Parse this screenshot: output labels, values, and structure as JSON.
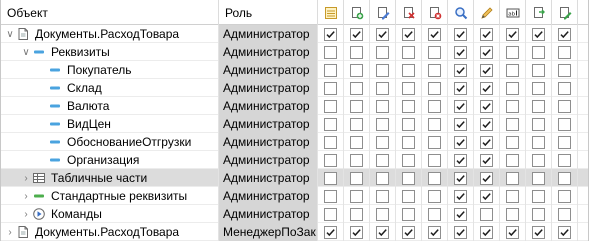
{
  "header": {
    "object_label": "Объект",
    "role_label": "Роль",
    "permission_icons": [
      "rights-table-icon",
      "add-icon",
      "edit-icon",
      "mark-delete-icon",
      "delete-icon",
      "view-icon",
      "interactive-edit-icon",
      "text-input-icon",
      "export-icon",
      "edit-green-icon"
    ]
  },
  "rows": [
    {
      "level": 0,
      "expander": "open",
      "icon": "document-icon",
      "object": "Документы.РасходТовара",
      "role": "Администратор",
      "checks": [
        true,
        true,
        true,
        true,
        true,
        true,
        true,
        true,
        true,
        true
      ],
      "selected": false
    },
    {
      "level": 1,
      "expander": "open",
      "icon": "attribute-group-icon",
      "object": "Реквизиты",
      "role": "Администратор",
      "checks": [
        false,
        false,
        false,
        false,
        false,
        true,
        true,
        false,
        false,
        false
      ],
      "selected": false
    },
    {
      "level": 2,
      "expander": "none",
      "icon": "attribute-icon",
      "object": "Покупатель",
      "role": "Администратор",
      "checks": [
        false,
        false,
        false,
        false,
        false,
        true,
        true,
        false,
        false,
        false
      ],
      "selected": false
    },
    {
      "level": 2,
      "expander": "none",
      "icon": "attribute-icon",
      "object": "Склад",
      "role": "Администратор",
      "checks": [
        false,
        false,
        false,
        false,
        false,
        true,
        true,
        false,
        false,
        false
      ],
      "selected": false
    },
    {
      "level": 2,
      "expander": "none",
      "icon": "attribute-icon",
      "object": "Валюта",
      "role": "Администратор",
      "checks": [
        false,
        false,
        false,
        false,
        false,
        true,
        true,
        false,
        false,
        false
      ],
      "selected": false
    },
    {
      "level": 2,
      "expander": "none",
      "icon": "attribute-icon",
      "object": "ВидЦен",
      "role": "Администратор",
      "checks": [
        false,
        false,
        false,
        false,
        false,
        true,
        true,
        false,
        false,
        false
      ],
      "selected": false
    },
    {
      "level": 2,
      "expander": "none",
      "icon": "attribute-icon",
      "object": "ОбоснованиеОтгрузки",
      "role": "Администратор",
      "checks": [
        false,
        false,
        false,
        false,
        false,
        true,
        true,
        false,
        false,
        false
      ],
      "selected": false
    },
    {
      "level": 2,
      "expander": "none",
      "icon": "attribute-icon",
      "object": "Организация",
      "role": "Администратор",
      "checks": [
        false,
        false,
        false,
        false,
        false,
        true,
        true,
        false,
        false,
        false
      ],
      "selected": false
    },
    {
      "level": 1,
      "expander": "closed",
      "icon": "table-icon",
      "object": "Табличные части",
      "role": "Администратор",
      "checks": [
        false,
        false,
        false,
        false,
        false,
        true,
        true,
        false,
        false,
        false
      ],
      "selected": true
    },
    {
      "level": 1,
      "expander": "closed",
      "icon": "standard-attribute-icon",
      "object": "Стандартные реквизиты",
      "role": "Администратор",
      "checks": [
        false,
        false,
        false,
        false,
        false,
        true,
        true,
        false,
        false,
        false
      ],
      "selected": false
    },
    {
      "level": 1,
      "expander": "closed",
      "icon": "command-icon",
      "object": "Команды",
      "role": "Администратор",
      "checks": [
        false,
        false,
        false,
        false,
        false,
        true,
        false,
        false,
        false,
        false
      ],
      "selected": false
    },
    {
      "level": 0,
      "expander": "closed",
      "icon": "document-icon",
      "object": "Документы.РасходТовара",
      "role": "МенеджерПоЗак",
      "checks": [
        true,
        true,
        true,
        true,
        true,
        true,
        true,
        true,
        true,
        true
      ],
      "selected": false
    }
  ]
}
